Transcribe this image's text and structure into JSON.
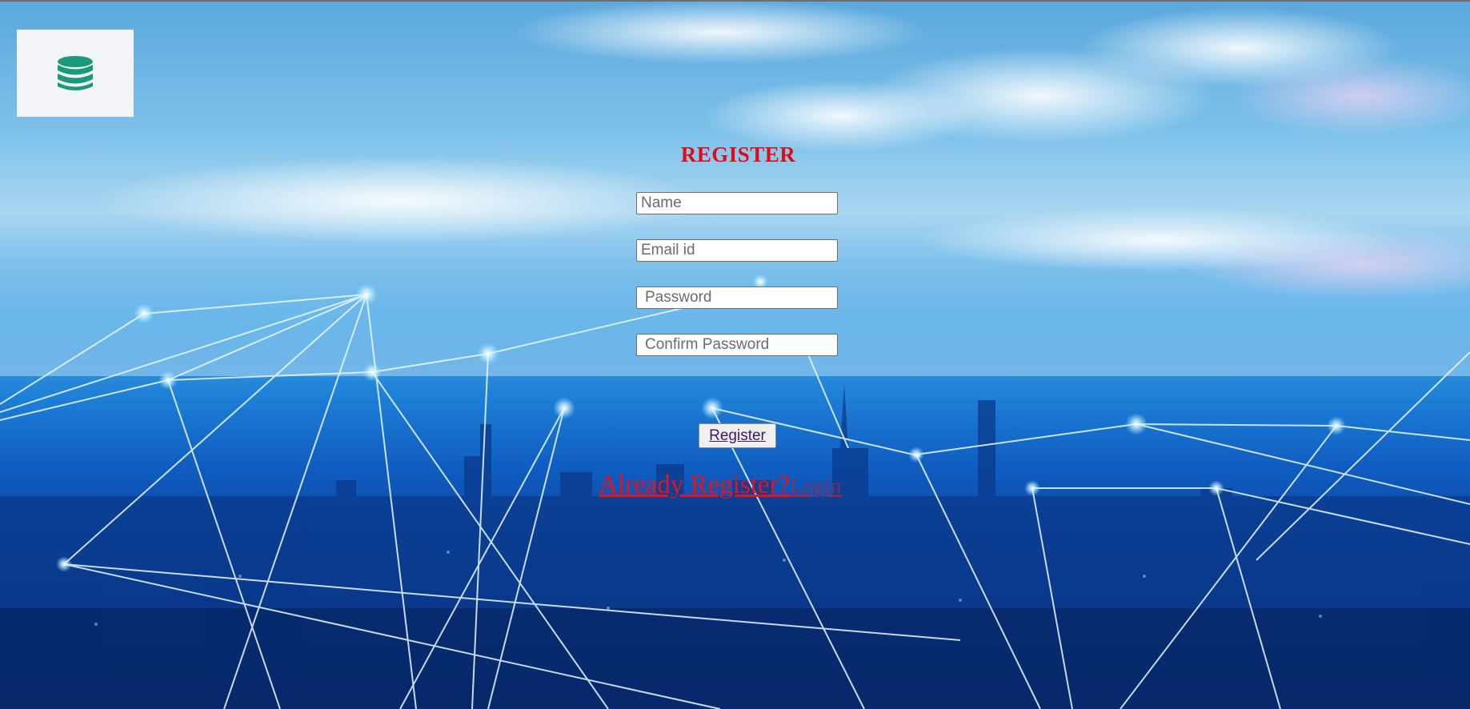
{
  "logo": {
    "icon": "database-icon",
    "color": "#1a9a7a"
  },
  "form": {
    "title": "REGISTER",
    "name_placeholder": "Name",
    "email_placeholder": "Email id",
    "password_placeholder": "Password",
    "confirm_placeholder": "Confirm Password",
    "register_label": "Register",
    "already_text": "Already Register?",
    "login_text": "Login"
  },
  "colors": {
    "title": "#e30a17",
    "link": "#e8121e"
  }
}
